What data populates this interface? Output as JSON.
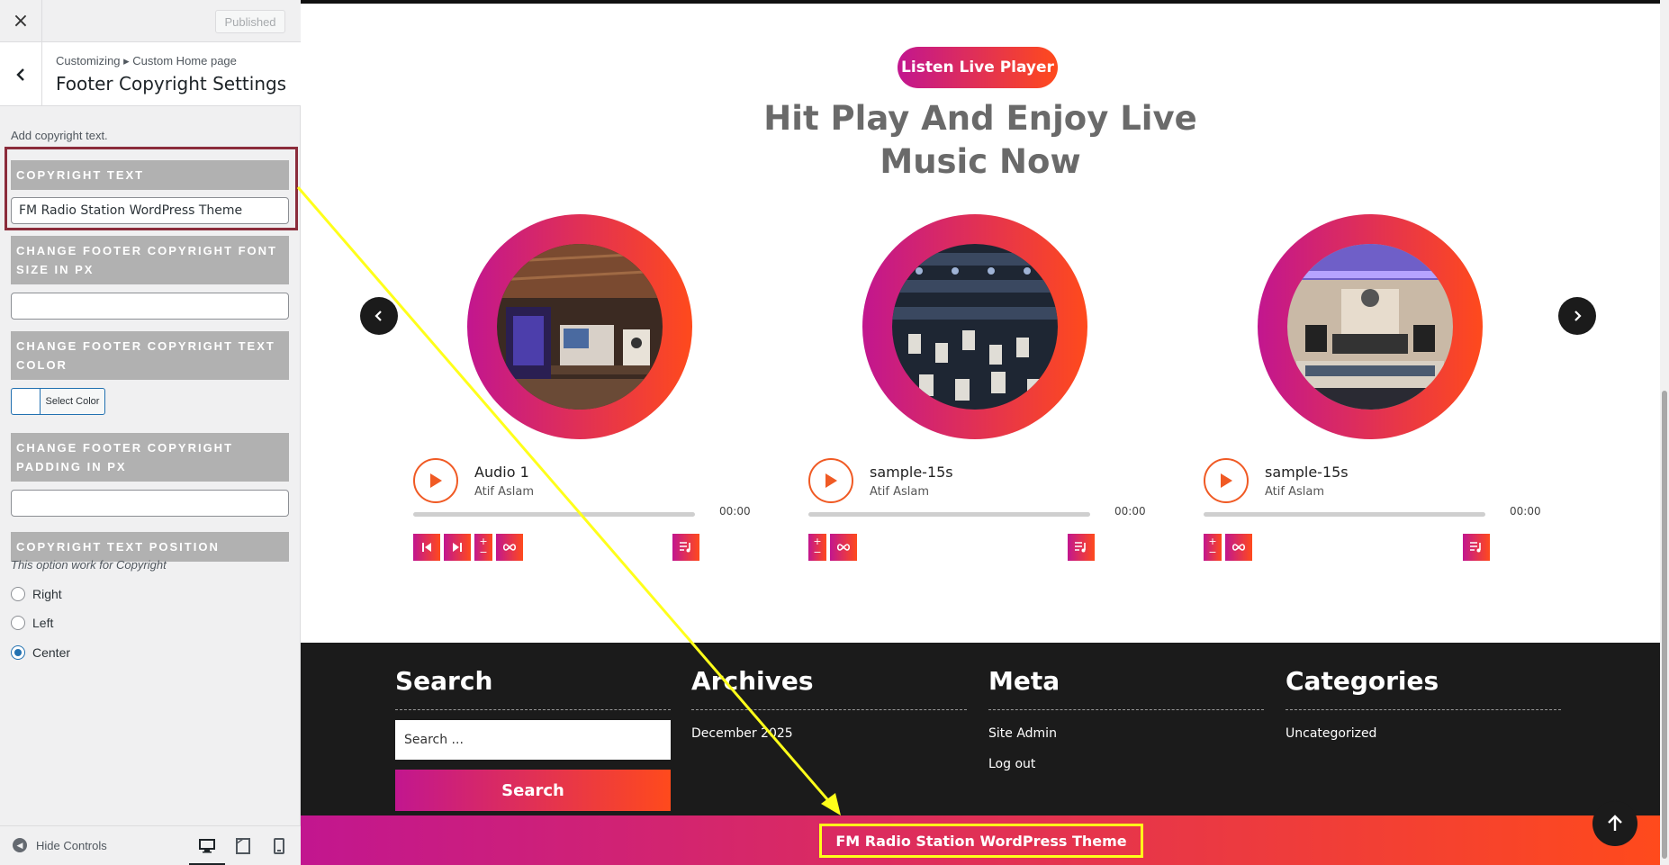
{
  "sidebar": {
    "close_label": "×",
    "published_label": "Published",
    "breadcrumb": "Customizing ▸ Custom Home page",
    "title": "Footer Copyright Settings",
    "description": "Add copyright text.",
    "copyright_text_label": "COPYRIGHT TEXT",
    "copyright_text_value": "FM Radio Station WordPress Theme",
    "font_size_label": "CHANGE FOOTER COPYRIGHT FONT SIZE IN PX",
    "font_size_value": "",
    "text_color_label": "CHANGE FOOTER COPYRIGHT TEXT COLOR",
    "select_color_label": "Select Color",
    "padding_label": "CHANGE FOOTER COPYRIGHT PADDING IN PX",
    "padding_value": "",
    "position_label": "COPYRIGHT TEXT POSITION",
    "position_note": "This option work for Copyright",
    "position_options": [
      "Right",
      "Left",
      "Center"
    ],
    "position_selected": "Center",
    "hide_controls_label": "Hide Controls",
    "devices": [
      "desktop",
      "tablet",
      "mobile"
    ],
    "active_device": "desktop"
  },
  "preview": {
    "badge": "Listen Live Player",
    "heading": "Hit Play And Enjoy Live Music Now",
    "tracks": [
      {
        "title": "Audio 1",
        "artist": "Atif Aslam",
        "time": "00:00"
      },
      {
        "title": "sample-15s",
        "artist": "Atif Aslam",
        "time": "00:00"
      },
      {
        "title": "sample-15s",
        "artist": "Atif Aslam",
        "time": "00:00"
      }
    ],
    "footer": {
      "search_title": "Search",
      "search_placeholder": "Search ...",
      "search_button": "Search",
      "archives_title": "Archives",
      "archives_items": [
        "December 2025"
      ],
      "meta_title": "Meta",
      "meta_items": [
        "Site Admin",
        "Log out"
      ],
      "categories_title": "Categories",
      "categories_items": [
        "Uncategorized"
      ]
    },
    "copyright": "FM Radio Station WordPress Theme"
  },
  "colors": {
    "gradient_start": "#c2168f",
    "gradient_end": "#ff4a1c",
    "highlight_red": "#8b2c3b",
    "highlight_yellow": "#ffff1a",
    "footer_bg": "#1b1b1b"
  }
}
